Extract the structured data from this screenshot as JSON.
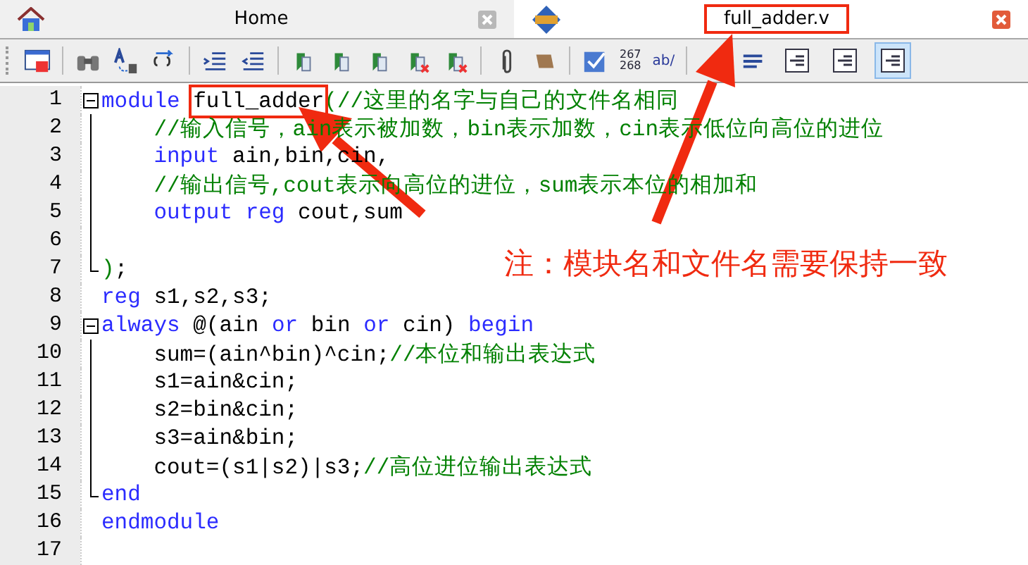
{
  "tabs": [
    {
      "title": "Home",
      "selected": false,
      "highlighted": false
    },
    {
      "title": "full_adder.v",
      "selected": true,
      "highlighted": true
    }
  ],
  "toolbar": {
    "line_numbers": [
      "267",
      "268"
    ],
    "spell_label": "ab/",
    "view_buttons": [
      {
        "selected": false
      },
      {
        "selected": false
      },
      {
        "selected": true
      }
    ]
  },
  "lines": [
    {
      "number": "1",
      "fold_open": true,
      "fold_guide": false,
      "fold_end": false,
      "tokens": [
        {
          "kind": "keyword",
          "text": "module "
        },
        {
          "kind": "text",
          "text": "full_adder",
          "boxed": true
        },
        {
          "kind": "comment",
          "text": "(//这里的名字与自己的文件名相同"
        }
      ]
    },
    {
      "number": "2",
      "fold_open": false,
      "fold_guide": true,
      "fold_end": false,
      "tokens": [
        {
          "kind": "comment",
          "text": "    //输入信号，ain表示被加数，bin表示加数，cin表示低位向高位的进位"
        }
      ]
    },
    {
      "number": "3",
      "fold_open": false,
      "fold_guide": true,
      "fold_end": false,
      "tokens": [
        {
          "kind": "keyword",
          "text": "    input"
        },
        {
          "kind": "text",
          "text": " ain,bin,cin,"
        }
      ]
    },
    {
      "number": "4",
      "fold_open": false,
      "fold_guide": true,
      "fold_end": false,
      "tokens": [
        {
          "kind": "comment",
          "text": "    //输出信号,cout表示向高位的进位，sum表示本位的相加和"
        }
      ]
    },
    {
      "number": "5",
      "fold_open": false,
      "fold_guide": true,
      "fold_end": false,
      "tokens": [
        {
          "kind": "keyword",
          "text": "    output reg"
        },
        {
          "kind": "text",
          "text": " cout,sum"
        }
      ]
    },
    {
      "number": "6",
      "fold_open": false,
      "fold_guide": true,
      "fold_end": false
    },
    {
      "number": "7",
      "fold_open": false,
      "fold_guide": false,
      "fold_end": true,
      "tokens": [
        {
          "kind": "comment",
          "text": ")"
        },
        {
          "kind": "text",
          "text": ";"
        }
      ]
    },
    {
      "number": "8",
      "fold_open": false,
      "fold_guide": false,
      "fold_end": false,
      "tokens": [
        {
          "kind": "keyword",
          "text": "reg"
        },
        {
          "kind": "text",
          "text": " s1,s2,s3;"
        }
      ]
    },
    {
      "number": "9",
      "fold_open": true,
      "fold_guide": false,
      "fold_end": false,
      "tokens": [
        {
          "kind": "keyword",
          "text": "always"
        },
        {
          "kind": "text",
          "text": " @(ain "
        },
        {
          "kind": "keyword",
          "text": "or"
        },
        {
          "kind": "text",
          "text": " bin "
        },
        {
          "kind": "keyword",
          "text": "or"
        },
        {
          "kind": "text",
          "text": " cin) "
        },
        {
          "kind": "keyword",
          "text": "begin"
        }
      ]
    },
    {
      "number": "10",
      "fold_open": false,
      "fold_guide": true,
      "fold_end": false,
      "tokens": [
        {
          "kind": "text",
          "text": "    sum=(ain^bin)^cin;"
        },
        {
          "kind": "comment",
          "text": "//本位和输出表达式"
        }
      ]
    },
    {
      "number": "11",
      "fold_open": false,
      "fold_guide": true,
      "fold_end": false,
      "tokens": [
        {
          "kind": "text",
          "text": "    s1=ain&cin;"
        }
      ]
    },
    {
      "number": "12",
      "fold_open": false,
      "fold_guide": true,
      "fold_end": false,
      "tokens": [
        {
          "kind": "text",
          "text": "    s2=bin&cin;"
        }
      ]
    },
    {
      "number": "13",
      "fold_open": false,
      "fold_guide": true,
      "fold_end": false,
      "tokens": [
        {
          "kind": "text",
          "text": "    s3=ain&bin;"
        }
      ]
    },
    {
      "number": "14",
      "fold_open": false,
      "fold_guide": true,
      "fold_end": false,
      "tokens": [
        {
          "kind": "text",
          "text": "    cout=(s1|s2)|s3;"
        },
        {
          "kind": "comment",
          "text": "//高位进位输出表达式"
        }
      ]
    },
    {
      "number": "15",
      "fold_open": false,
      "fold_guide": false,
      "fold_end": true,
      "tokens": [
        {
          "kind": "keyword",
          "text": "end"
        }
      ]
    },
    {
      "number": "16",
      "fold_open": false,
      "fold_guide": false,
      "fold_end": false,
      "tokens": [
        {
          "kind": "keyword",
          "text": "endmodule"
        }
      ]
    },
    {
      "number": "17",
      "fold_open": false,
      "fold_guide": false,
      "fold_end": false
    }
  ],
  "annotation": {
    "note": "注：模块名和文件名需要保持一致"
  }
}
